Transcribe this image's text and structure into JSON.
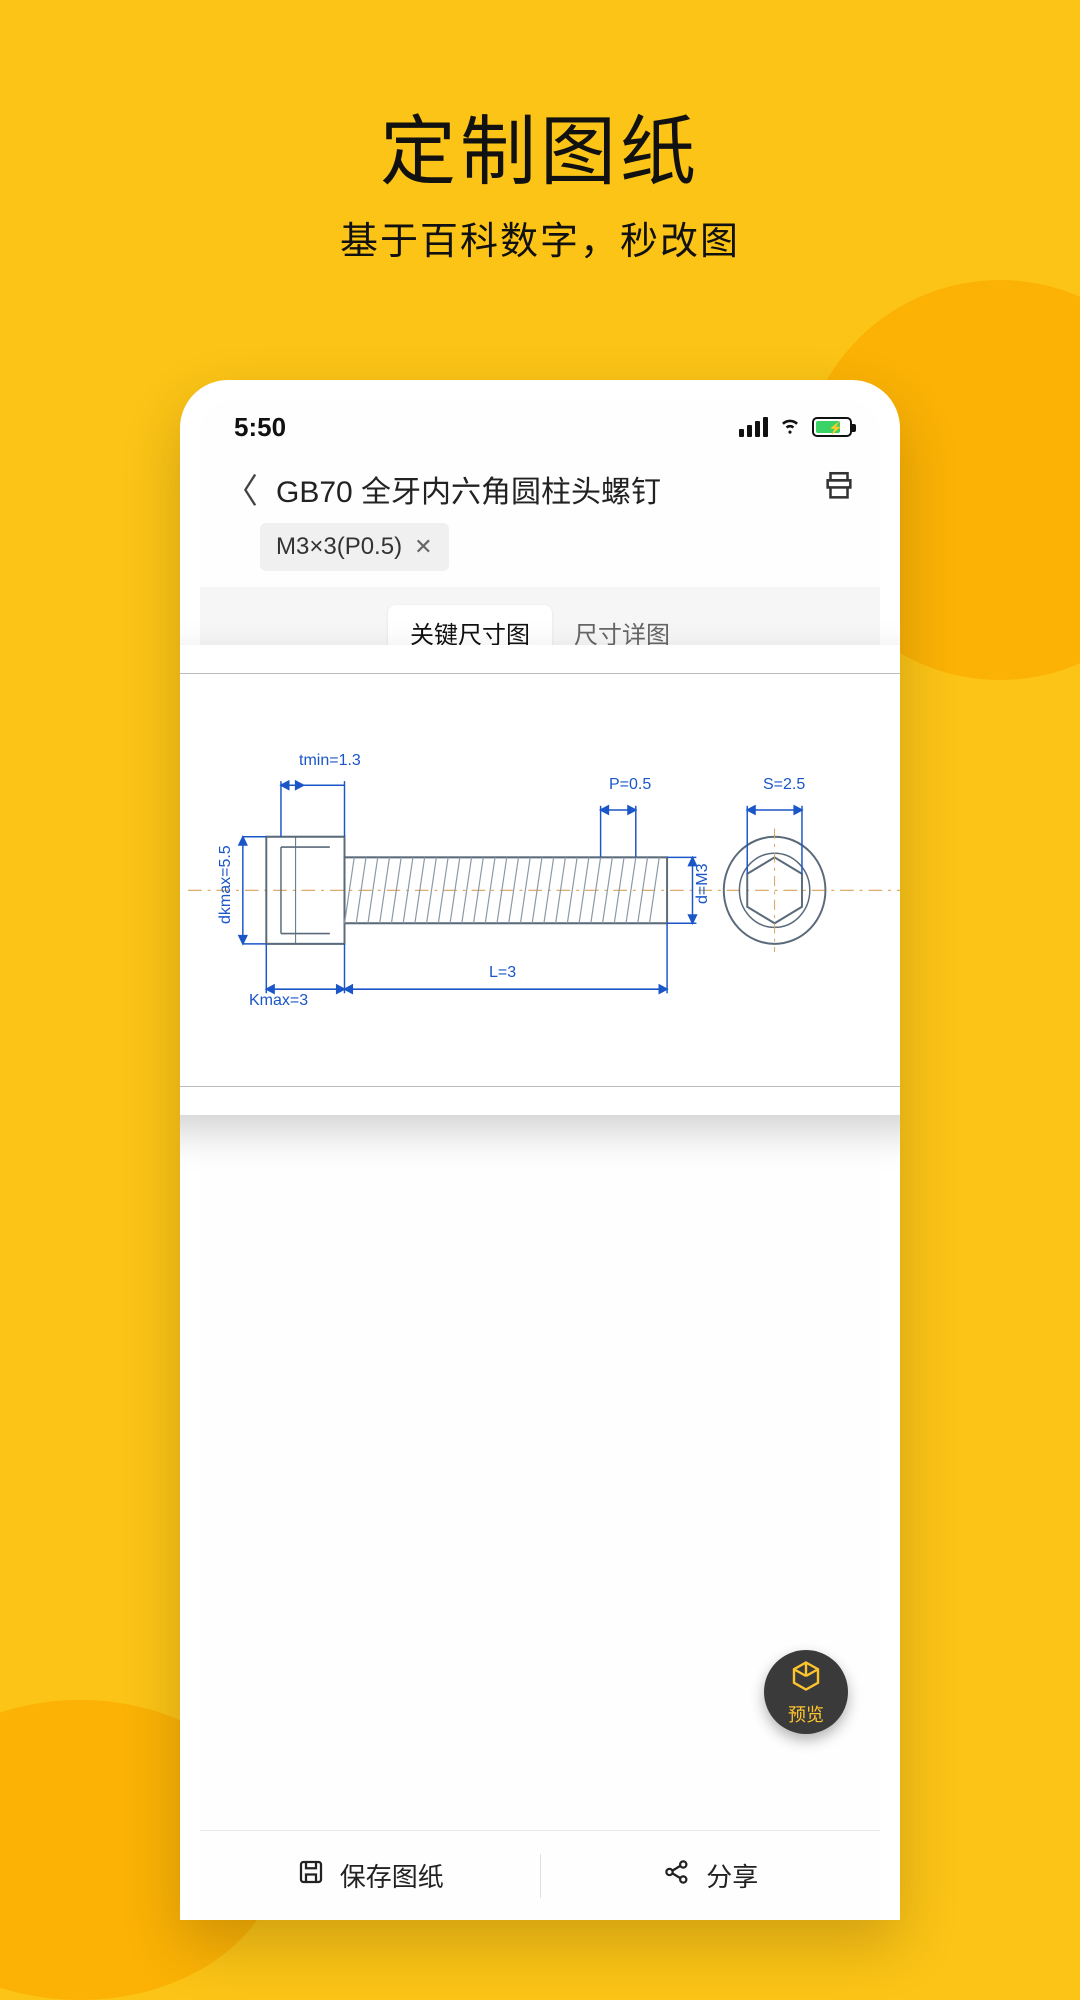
{
  "promo": {
    "title": "定制图纸",
    "subtitle": "基于百科数字，秒改图"
  },
  "statusbar": {
    "time": "5:50"
  },
  "header": {
    "title": "GB70 全牙内六角圆柱头螺钉",
    "tag": "M3×3(P0.5)"
  },
  "tabs": {
    "active": "关键尺寸图",
    "other": "尺寸详图"
  },
  "drawing": {
    "tmin": "tmin=1.3",
    "p": "P=0.5",
    "s": "S=2.5",
    "dkmax": "dkmax=5.5",
    "d": "d=M3",
    "kmax": "Kmax=3",
    "l": "L=3"
  },
  "fab": {
    "label": "预览"
  },
  "bottom": {
    "save": "保存图纸",
    "share": "分享"
  }
}
